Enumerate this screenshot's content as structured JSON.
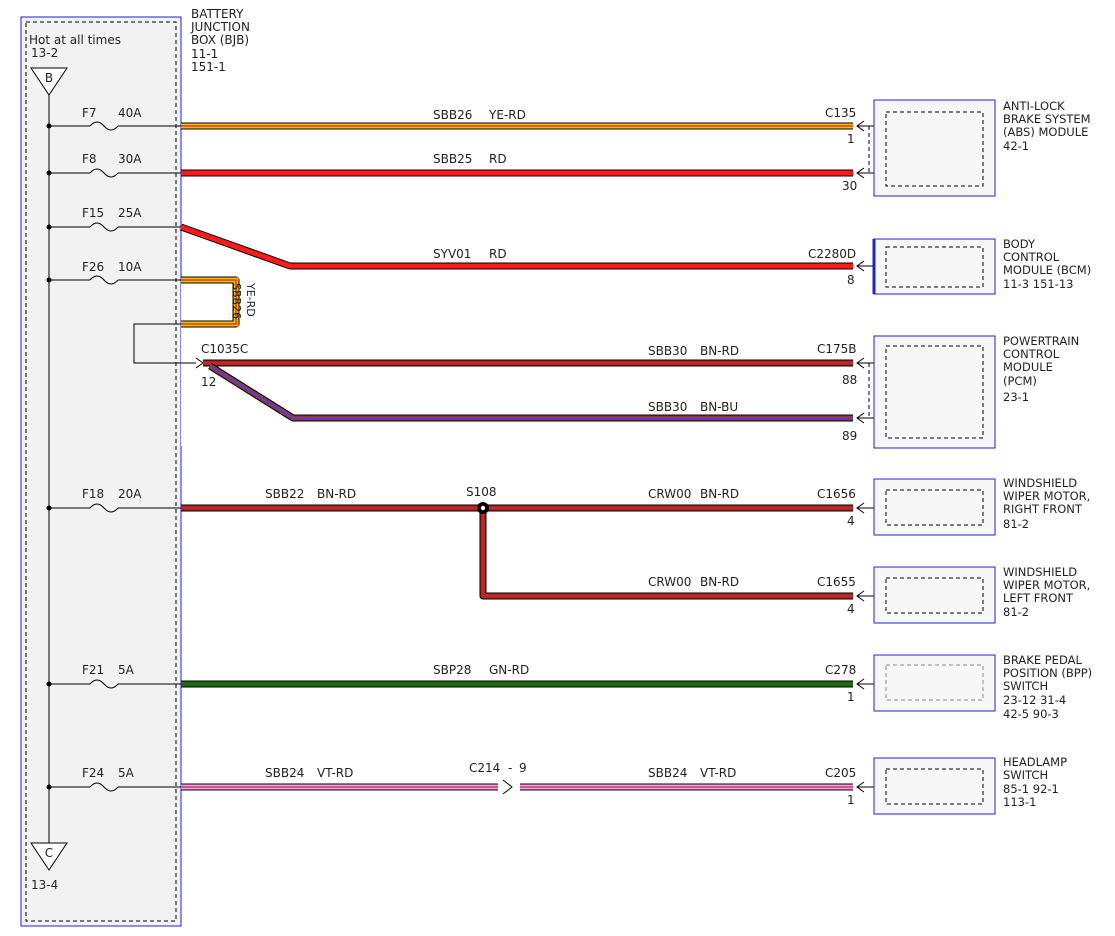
{
  "bjb": {
    "title_lines": [
      "BATTERY",
      "JUNCTION",
      "BOX (BJB)",
      "11-1",
      "151-1"
    ],
    "hot_label": "Hot at all times",
    "ref_top": "13-2",
    "tri_top": "B",
    "tri_bottom": "C",
    "ref_bottom": "13-4"
  },
  "fuses": [
    {
      "id": "F7",
      "rating": "40A"
    },
    {
      "id": "F8",
      "rating": "30A"
    },
    {
      "id": "F15",
      "rating": "25A"
    },
    {
      "id": "F26",
      "rating": "10A"
    },
    {
      "id": "F18",
      "rating": "20A"
    },
    {
      "id": "F21",
      "rating": "5A"
    },
    {
      "id": "F24",
      "rating": "5A"
    }
  ],
  "wires": [
    {
      "circuit": "SBB26",
      "color_code": "YE-RD",
      "stroke": "#f2c200",
      "stripe": "#e02020"
    },
    {
      "circuit": "SBB25",
      "color_code": "RD",
      "stroke": "#ff1a1a",
      "stripe": ""
    },
    {
      "circuit": "SYV01",
      "color_code": "RD",
      "stroke": "#ff1a1a",
      "stripe": ""
    },
    {
      "circuit": "SBB26",
      "color_code": "YE-RD",
      "stroke": "#f2c200",
      "stripe": "#e02020"
    },
    {
      "circuit": "SBB30",
      "color_code": "BN-RD",
      "stroke": "#a52a2a",
      "stripe": "#e02020"
    },
    {
      "circuit": "SBB30",
      "color_code": "BN-BU",
      "stroke": "#8b3a3a",
      "stripe": "#5a3adf"
    },
    {
      "circuit": "SBB22",
      "color_code": "BN-RD",
      "stroke": "#a52a2a",
      "stripe": "#e02020"
    },
    {
      "circuit": "CRW00",
      "color_code": "BN-RD",
      "stroke": "#a52a2a",
      "stripe": "#e02020"
    },
    {
      "circuit": "CRW00",
      "color_code": "BN-RD",
      "stroke": "#a52a2a",
      "stripe": "#e02020"
    },
    {
      "circuit": "SBP28",
      "color_code": "GN-RD",
      "stroke": "#1f6b12",
      "stripe": "#c03020"
    },
    {
      "circuit": "SBB24",
      "color_code": "VT-RD",
      "stroke": "#f0a0dc",
      "stripe": "#d02070"
    },
    {
      "circuit": "SBB24",
      "color_code": "VT-RD",
      "stroke": "#f0a0dc",
      "stripe": "#d02070"
    }
  ],
  "connectors": {
    "c135": {
      "name": "C135",
      "pins": [
        "1",
        "30"
      ]
    },
    "c2280d": {
      "name": "C2280D",
      "pins": [
        "8"
      ]
    },
    "c1035c": {
      "name": "C1035C",
      "pins": [
        "12"
      ]
    },
    "c175b": {
      "name": "C175B",
      "pins": [
        "88",
        "89"
      ]
    },
    "c1656": {
      "name": "C1656",
      "pins": [
        "4"
      ]
    },
    "c1655": {
      "name": "C1655",
      "pins": [
        "4"
      ]
    },
    "c278": {
      "name": "C278",
      "pins": [
        "1"
      ]
    },
    "c214": {
      "name": "C214",
      "sep": "-",
      "pin": "9"
    },
    "c205": {
      "name": "C205",
      "pins": [
        "1"
      ]
    }
  },
  "splice": {
    "name": "S108"
  },
  "modules": [
    {
      "lines": [
        "ANTI-LOCK",
        "BRAKE SYSTEM",
        "(ABS) MODULE",
        "42-1"
      ]
    },
    {
      "lines": [
        "BODY",
        "CONTROL",
        "MODULE (BCM)",
        "11-3  151-13"
      ]
    },
    {
      "lines": [
        "POWERTRAIN",
        "CONTROL",
        "MODULE",
        "(PCM)",
        "23-1"
      ]
    },
    {
      "lines": [
        "WINDSHIELD",
        "WIPER MOTOR,",
        "RIGHT FRONT",
        "81-2"
      ]
    },
    {
      "lines": [
        "WINDSHIELD",
        "WIPER MOTOR,",
        "LEFT FRONT",
        "81-2"
      ]
    },
    {
      "lines": [
        "BRAKE PEDAL",
        "POSITION (BPP)",
        "SWITCH",
        "23-12    31-4",
        "42-5      90-3"
      ]
    },
    {
      "lines": [
        "HEADLAMP",
        "SWITCH",
        "85-1   92-1",
        "113-1"
      ]
    }
  ]
}
